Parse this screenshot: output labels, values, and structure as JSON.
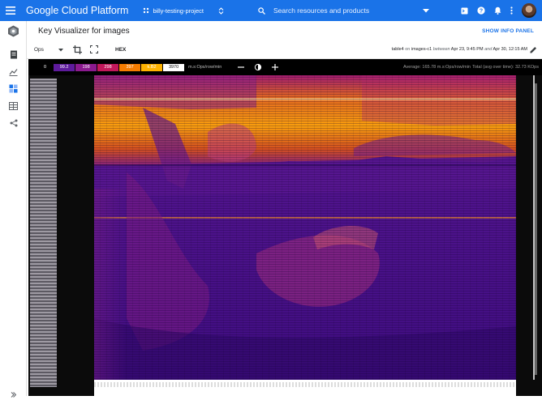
{
  "topbar": {
    "brand": "Google Cloud Platform",
    "project": "billy-testing-project",
    "search_placeholder": "Search resources and products",
    "icons": [
      "menu-icon",
      "project-picker-icon",
      "search-icon",
      "dropdown-icon",
      "cloud-shell-icon",
      "help-icon",
      "notifications-icon",
      "more-icon",
      "avatar"
    ]
  },
  "sidenav": {
    "icons": [
      "key-visualizer-logo-icon",
      "document-icon",
      "chart-icon",
      "heatmap-icon",
      "table-icon",
      "share-icon",
      "expand-icon"
    ]
  },
  "header": {
    "title": "Key Visualizer for images",
    "show_info": "SHOW INFO PANEL"
  },
  "toolbar": {
    "metric_value": "Ops",
    "hex_label": "HEX",
    "table_name": "table4",
    "on_text": "on",
    "instance": "images-c1",
    "between_text": "between",
    "start_time": "Apr 23, 9:45 PM",
    "and_text": "and",
    "end_time": "Apr 30, 12:15 AM"
  },
  "scale": {
    "zero": "0",
    "stops": [
      {
        "label": "99.2",
        "color": "#5e1b9c",
        "text": "#ffffff"
      },
      {
        "label": "198",
        "color": "#8b1a8f",
        "text": "#ffffff"
      },
      {
        "label": "298",
        "color": "#c2185b",
        "text": "#ffffff"
      },
      {
        "label": "397",
        "color": "#f57c00",
        "text": "#ffffff"
      },
      {
        "label": "k.B2",
        "color": "#ffb300",
        "text": "#ffffff"
      },
      {
        "label": "3970",
        "color": "#ffffff",
        "text": "#000000"
      }
    ],
    "unit": "m.s:Ops/row/min",
    "average": "Average: 165.78 m.s:Ops/row/min",
    "total": "Total (avg over time): 32.73 KOps"
  },
  "colors": {
    "accent": "#1a73e8",
    "heatmap_base": "#3e0d80",
    "heatmap_hot": "#f99e0e"
  }
}
